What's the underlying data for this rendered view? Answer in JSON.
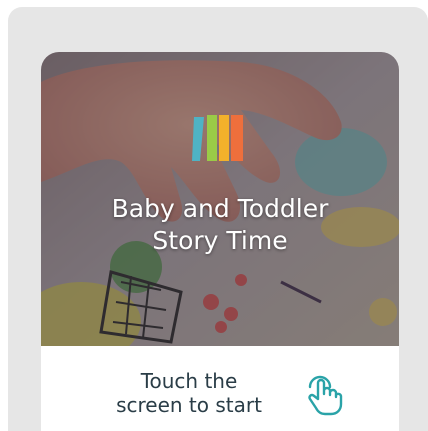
{
  "title": {
    "line1": "Baby and Toddler",
    "line2": "Story Time"
  },
  "start": {
    "line1": "Touch the",
    "line2": "screen to start"
  },
  "logo": {
    "icon": "book-stack-logo",
    "colors": [
      "#4fb3c4",
      "#9acb47",
      "#f3b12b",
      "#ee6f3c"
    ]
  },
  "touch_icon": {
    "icon": "hand-tap-icon",
    "color": "#2aa3a8"
  },
  "colors": {
    "panel": "#e6e6e6",
    "text_dark": "#2a3d47",
    "title_text": "#ffffff"
  }
}
